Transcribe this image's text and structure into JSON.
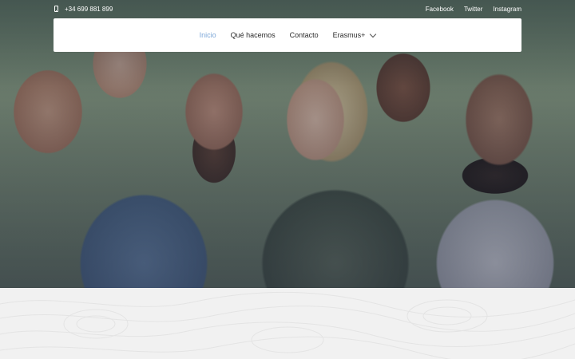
{
  "topbar": {
    "phone": "+34 699 881 899",
    "social": [
      {
        "label": "Facebook"
      },
      {
        "label": "Twitter"
      },
      {
        "label": "Instagram"
      }
    ]
  },
  "nav": {
    "items": [
      {
        "label": "Inicio",
        "active": true
      },
      {
        "label": "Qué hacemos"
      },
      {
        "label": "Contacto"
      },
      {
        "label": "Erasmus+",
        "has_dropdown": true
      }
    ]
  },
  "colors": {
    "active_link": "#7da7d8",
    "lower_bg": "#f1f1f1"
  },
  "icons": [
    "phone-icon",
    "chevron-down-icon"
  ]
}
